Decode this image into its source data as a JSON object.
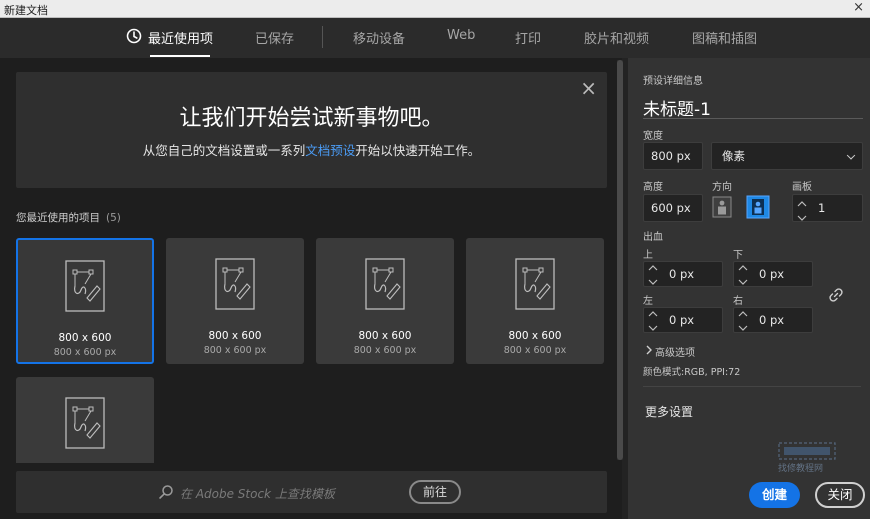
{
  "window": {
    "title": "新建文档",
    "close": "×"
  },
  "tabs": {
    "recent": "最近使用项",
    "saved": "已保存",
    "mobile": "移动设备",
    "web": "Web",
    "print": "打印",
    "film": "胶片和视频",
    "art": "图稿和插图"
  },
  "hero": {
    "title": "让我们开始尝试新事物吧。",
    "sub_before": "从您自己的文档设置或一系列",
    "sub_link": "文档预设",
    "sub_after": "开始以快速开始工作。",
    "close": "×"
  },
  "recent": {
    "label": "您最近使用的项目",
    "count": "(5)",
    "items": [
      {
        "name": "800 x 600",
        "dims": "800 x 600 px"
      },
      {
        "name": "800 x 600",
        "dims": "800 x 600 px"
      },
      {
        "name": "800 x 600",
        "dims": "800 x 600 px"
      },
      {
        "name": "800 x 600",
        "dims": "800 x 600 px"
      },
      {
        "name": "",
        "dims": ""
      }
    ]
  },
  "search": {
    "placeholder": "在 Adobe Stock 上查找模板",
    "go": "前往"
  },
  "details": {
    "section_title": "预设详细信息",
    "doc_name": "未标题-1",
    "width_label": "宽度",
    "width_value": "800 px",
    "unit_value": "像素",
    "height_label": "高度",
    "height_value": "600 px",
    "orientation_label": "方向",
    "artboards_label": "画板",
    "artboards_value": "1",
    "bleed_label": "出血",
    "top_label": "上",
    "top_value": "0 px",
    "bottom_label": "下",
    "bottom_value": "0 px",
    "left_label": "左",
    "left_value": "0 px",
    "right_label": "右",
    "right_value": "0 px",
    "advanced": "高级选项",
    "color_mode": "颜色模式:RGB, PPI:72",
    "more_settings": "更多设置"
  },
  "buttons": {
    "create": "创建",
    "close": "关闭"
  },
  "watermark": {
    "text": "找修教程网"
  },
  "colors": {
    "accent": "#1473e6",
    "link": "#4b9cf5"
  }
}
